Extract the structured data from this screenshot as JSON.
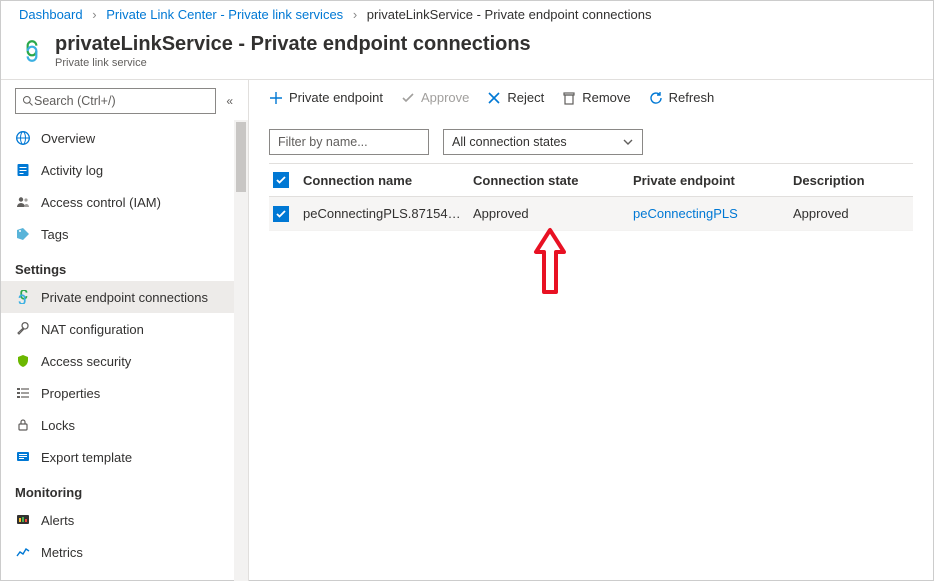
{
  "breadcrumb": {
    "items": [
      {
        "label": "Dashboard"
      },
      {
        "label": "Private Link Center - Private link services"
      },
      {
        "label": "privateLinkService - Private endpoint connections"
      }
    ]
  },
  "header": {
    "title": "privateLinkService - Private endpoint connections",
    "subtitle": "Private link service"
  },
  "sidebar": {
    "search_placeholder": "Search (Ctrl+/)",
    "top_items": [
      {
        "label": "Overview",
        "icon": "globe-icon"
      },
      {
        "label": "Activity log",
        "icon": "log-icon"
      },
      {
        "label": "Access control (IAM)",
        "icon": "people-icon"
      },
      {
        "label": "Tags",
        "icon": "tag-icon"
      }
    ],
    "sections": [
      {
        "label": "Settings",
        "items": [
          {
            "label": "Private endpoint connections",
            "icon": "endpoint-icon",
            "selected": true
          },
          {
            "label": "NAT configuration",
            "icon": "wrench-icon"
          },
          {
            "label": "Access security",
            "icon": "shield-icon"
          },
          {
            "label": "Properties",
            "icon": "properties-icon"
          },
          {
            "label": "Locks",
            "icon": "lock-icon"
          },
          {
            "label": "Export template",
            "icon": "export-icon"
          }
        ]
      },
      {
        "label": "Monitoring",
        "items": [
          {
            "label": "Alerts",
            "icon": "alerts-icon"
          },
          {
            "label": "Metrics",
            "icon": "metrics-icon"
          }
        ]
      }
    ]
  },
  "toolbar": {
    "add_label": "Private endpoint",
    "approve_label": "Approve",
    "reject_label": "Reject",
    "remove_label": "Remove",
    "refresh_label": "Refresh"
  },
  "filters": {
    "name_placeholder": "Filter by name...",
    "state_label": "All connection states"
  },
  "table": {
    "headers": {
      "name": "Connection name",
      "state": "Connection state",
      "endpoint": "Private endpoint",
      "description": "Description"
    },
    "rows": [
      {
        "name": "peConnectingPLS.871541...",
        "state": "Approved",
        "endpoint": "peConnectingPLS",
        "description": "Approved",
        "checked": true
      }
    ]
  }
}
